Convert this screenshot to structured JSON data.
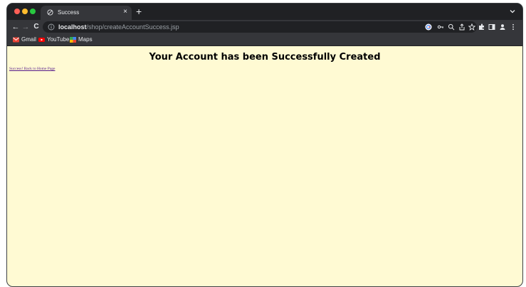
{
  "browser": {
    "tab": {
      "title": "Success",
      "close_glyph": "×",
      "icon": "globe-icon"
    },
    "new_tab_glyph": "+",
    "tab_menu_icon": "chevron-down-icon",
    "nav": {
      "back_glyph": "←",
      "forward_glyph": "→",
      "reload_glyph": "C"
    },
    "address": {
      "host": "localhost",
      "path": "/shop/createAccountSuccess.jsp",
      "icon": "info-icon"
    },
    "toolbar_icons": [
      "google-icon",
      "key-icon",
      "zoom-icon",
      "share-icon",
      "star-icon",
      "extensions-icon",
      "sidepanel-icon",
      "profile-icon",
      "menu-icon"
    ],
    "bookmarks": [
      {
        "label": "Gmail",
        "icon": "gmail-icon"
      },
      {
        "label": "YouTube",
        "icon": "youtube-icon"
      },
      {
        "label": "Maps",
        "icon": "maps-icon"
      }
    ]
  },
  "page": {
    "heading": "Your Account has been Successfully Created",
    "link_text": "Success! Back to Home Page",
    "background": "#fffad3"
  }
}
